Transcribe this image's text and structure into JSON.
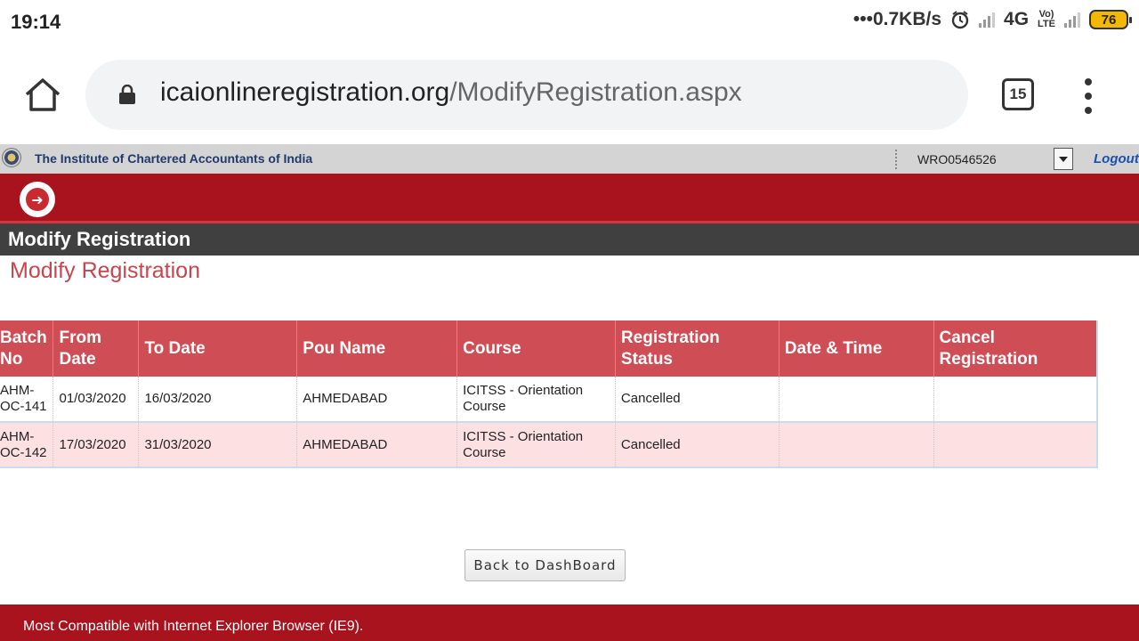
{
  "status_bar": {
    "time": "19:14",
    "net_speed": "•••0.7KB/s",
    "network": "4G",
    "volte": "Vo)) LTE",
    "battery": "76"
  },
  "browser": {
    "url_host": "icaionlineregistration.org",
    "url_path": "/ModifyRegistration.aspx",
    "tab_count": "15"
  },
  "site_header": {
    "institute_name": "The Institute of Chartered Accountants of India",
    "user_id": "WRO0546526",
    "logout_label": "Logout"
  },
  "page": {
    "dark_title": "Modify Registration",
    "sub_title": "Modify Registration"
  },
  "table": {
    "headers": [
      "Batch No",
      "From Date",
      "To Date",
      "Pou Name",
      "Course",
      "Registration Status",
      "Date & Time",
      "Cancel Registration"
    ],
    "rows": [
      {
        "batch_no": "AHM-OC-141",
        "from_date": "01/03/2020",
        "to_date": "16/03/2020",
        "pou_name": "AHMEDABAD",
        "course": "ICITSS - Orientation Course",
        "status": "Cancelled",
        "date_time": "",
        "cancel": ""
      },
      {
        "batch_no": "AHM-OC-142",
        "from_date": "17/03/2020",
        "to_date": "31/03/2020",
        "pou_name": "AHMEDABAD",
        "course": "ICITSS - Orientation Course",
        "status": "Cancelled",
        "date_time": "",
        "cancel": ""
      }
    ]
  },
  "back_button_label": "Back to DashBoard",
  "footer_text": "Most Compatible with Internet Explorer Browser (IE9)."
}
